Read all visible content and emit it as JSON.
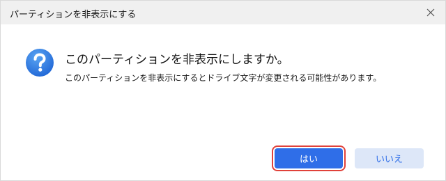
{
  "dialog": {
    "title": "パーティションを非表示にする",
    "heading": "このパーティションを非表示にしますか。",
    "message": "このパーティションを非表示にするとドライブ文字が変更される可能性があります。",
    "yes_label": "はい",
    "no_label": "いいえ",
    "icon": "question-icon",
    "close_icon": "close-icon"
  },
  "colors": {
    "titlebar": "#f0f0f0",
    "primary_button": "#2f6ee8",
    "secondary_button": "#dde7f8",
    "focus_outline": "#e0413a",
    "icon_blue": "#2c7be5"
  }
}
